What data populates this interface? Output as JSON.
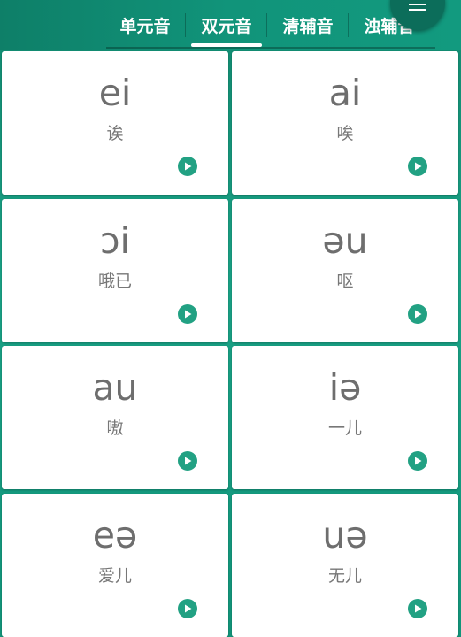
{
  "tabs": [
    {
      "label": "单元音",
      "active": false
    },
    {
      "label": "双元音",
      "active": true
    },
    {
      "label": "清辅音",
      "active": false
    },
    {
      "label": "浊辅音",
      "active": false
    }
  ],
  "menu_icon": "hamburger-menu-icon",
  "play_icon": "play-circle-icon",
  "colors": {
    "accent": "#1aa286",
    "play": "#22a183",
    "text": "#6e6e6e"
  },
  "cards": [
    {
      "symbol": "ei",
      "hint": "诶"
    },
    {
      "symbol": "ai",
      "hint": "唉"
    },
    {
      "symbol": "ɔi",
      "hint": "哦已"
    },
    {
      "symbol": "əu",
      "hint": "呕"
    },
    {
      "symbol": "au",
      "hint": "嗷"
    },
    {
      "symbol": "iə",
      "hint": "一儿"
    },
    {
      "symbol": "eə",
      "hint": "爱儿"
    },
    {
      "symbol": "uə",
      "hint": "无儿"
    }
  ]
}
